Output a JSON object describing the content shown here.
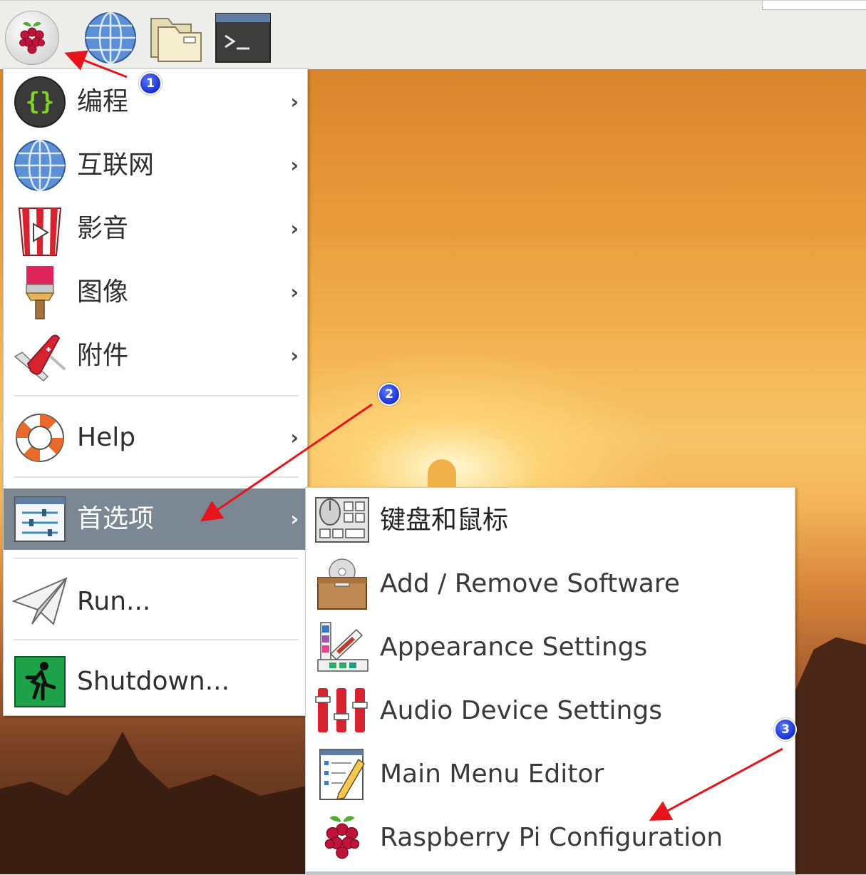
{
  "panel": {
    "launchers": [
      {
        "name": "raspberry-menu",
        "icon": "raspberry-pi-logo-icon"
      },
      {
        "name": "web-browser",
        "icon": "globe-icon"
      },
      {
        "name": "file-manager",
        "icon": "folder-icon"
      },
      {
        "name": "terminal",
        "icon": "terminal-icon"
      }
    ]
  },
  "main_menu": {
    "items": [
      {
        "label": "编程",
        "icon": "braces-icon",
        "arrow": "›"
      },
      {
        "label": "互联网",
        "icon": "globe-icon",
        "arrow": "›"
      },
      {
        "label": "影音",
        "icon": "popcorn-play-icon",
        "arrow": "›"
      },
      {
        "label": "图像",
        "icon": "paint-brush-icon",
        "arrow": "›"
      },
      {
        "label": "附件",
        "icon": "pocket-knife-icon",
        "arrow": "›"
      },
      {
        "label": "Help",
        "icon": "lifebuoy-icon",
        "arrow": "›"
      },
      {
        "label": "首选项",
        "icon": "sliders-icon",
        "arrow": "›",
        "active": true
      },
      {
        "label": "Run...",
        "icon": "paper-plane-icon"
      },
      {
        "label": "Shutdown...",
        "icon": "exit-running-man-icon"
      }
    ]
  },
  "prefs_submenu": {
    "items": [
      {
        "label": "键盘和鼠标",
        "icon": "keyboard-mouse-icon"
      },
      {
        "label": "Add / Remove Software",
        "icon": "software-box-icon"
      },
      {
        "label": "Appearance Settings",
        "icon": "color-swatch-icon"
      },
      {
        "label": "Audio Device Settings",
        "icon": "audio-mixer-icon"
      },
      {
        "label": "Main Menu Editor",
        "icon": "menu-editor-icon"
      },
      {
        "label": "Raspberry Pi Configuration",
        "icon": "raspberry-pi-logo-icon"
      }
    ]
  },
  "annotations": {
    "badges": [
      "1",
      "2",
      "3"
    ],
    "arrow_color": "#e8141b"
  },
  "colors": {
    "active_item_bg": "#7b8893",
    "panel_bg": "#ededeb",
    "badge_blue": "#1a2fcf"
  }
}
